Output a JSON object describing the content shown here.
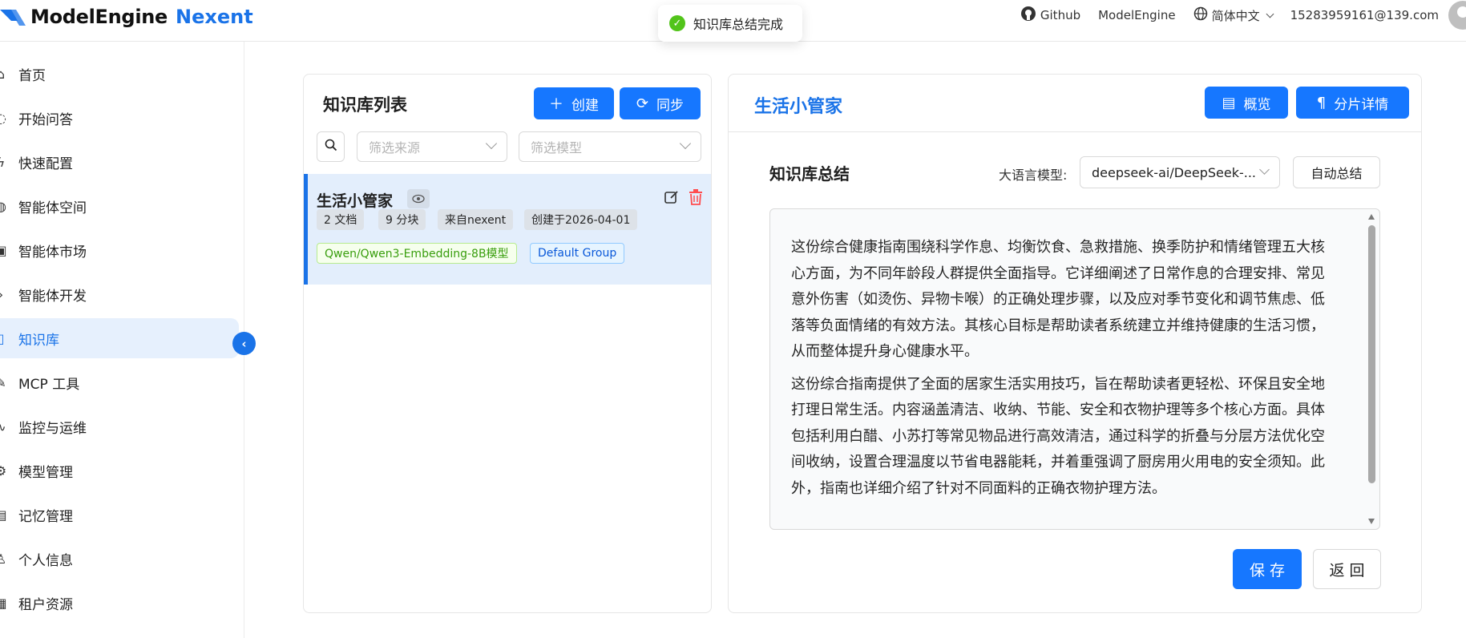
{
  "header": {
    "logo_primary": "ModelEngine",
    "logo_secondary": "Nexent",
    "github_label": "Github",
    "modelengine_label": "ModelEngine",
    "language_label": "简体中文",
    "user_email": "15283959161@139.com"
  },
  "toast": {
    "message": "知识库总结完成"
  },
  "sidebar": {
    "items": [
      {
        "label": "首页",
        "icon": "home-icon"
      },
      {
        "label": "开始问答",
        "icon": "chat-icon"
      },
      {
        "label": "快速配置",
        "icon": "lightning-icon"
      },
      {
        "label": "智能体空间",
        "icon": "globe-icon"
      },
      {
        "label": "智能体市场",
        "icon": "market-icon"
      },
      {
        "label": "智能体开发",
        "icon": "chevron-right-icon"
      },
      {
        "label": "知识库",
        "icon": "book-icon"
      },
      {
        "label": "MCP 工具",
        "icon": "tool-icon"
      },
      {
        "label": "监控与运维",
        "icon": "monitor-icon"
      },
      {
        "label": "模型管理",
        "icon": "gear-icon"
      },
      {
        "label": "记忆管理",
        "icon": "memory-icon"
      },
      {
        "label": "个人信息",
        "icon": "user-icon"
      },
      {
        "label": "租户资源",
        "icon": "resource-icon"
      }
    ],
    "active_index": 6
  },
  "kb_list": {
    "title": "知识库列表",
    "create_label": "创建",
    "sync_label": "同步",
    "filter_source_placeholder": "筛选来源",
    "filter_model_placeholder": "筛选模型",
    "items": [
      {
        "name": "生活小管家",
        "docs": "2 文档",
        "chunks": "9 分块",
        "source": "来自nexent",
        "created": "创建于2026-04-01",
        "model_tag": "Qwen/Qwen3-Embedding-8B模型",
        "group_tag": "Default Group"
      }
    ]
  },
  "kb_detail": {
    "title": "生活小管家",
    "overview_label": "概览",
    "chunks_label": "分片详情",
    "summary_title": "知识库总结",
    "llm_label": "大语言模型:",
    "llm_value": "deepseek-ai/DeepSeek-...",
    "auto_summary_label": "自动总结",
    "summary_paragraphs": [
      "这份综合健康指南围绕科学作息、均衡饮食、急救措施、换季防护和情绪管理五大核心方面，为不同年龄段人群提供全面指导。它详细阐述了日常作息的合理安排、常见意外伤害（如烫伤、异物卡喉）的正确处理步骤，以及应对季节变化和调节焦虑、低落等负面情绪的有效方法。其核心目标是帮助读者系统建立并维持健康的生活习惯，从而整体提升身心健康水平。",
      "这份综合指南提供了全面的居家生活实用技巧，旨在帮助读者更轻松、环保且安全地打理日常生活。内容涵盖清洁、收纳、节能、安全和衣物护理等多个核心方面。具体包括利用白醋、小苏打等常见物品进行高效清洁，通过科学的折叠与分层方法优化空间收纳，设置合理温度以节省电器能耗，并着重强调了厨房用火用电的安全须知。此外，指南也详细介绍了针对不同面料的正确衣物护理方法。"
    ],
    "save_label": "保 存",
    "back_label": "返 回"
  },
  "colors": {
    "primary": "#1677ff",
    "brand_blue": "#1a73e8",
    "success": "#52c41a",
    "danger": "#ff4d4f"
  }
}
